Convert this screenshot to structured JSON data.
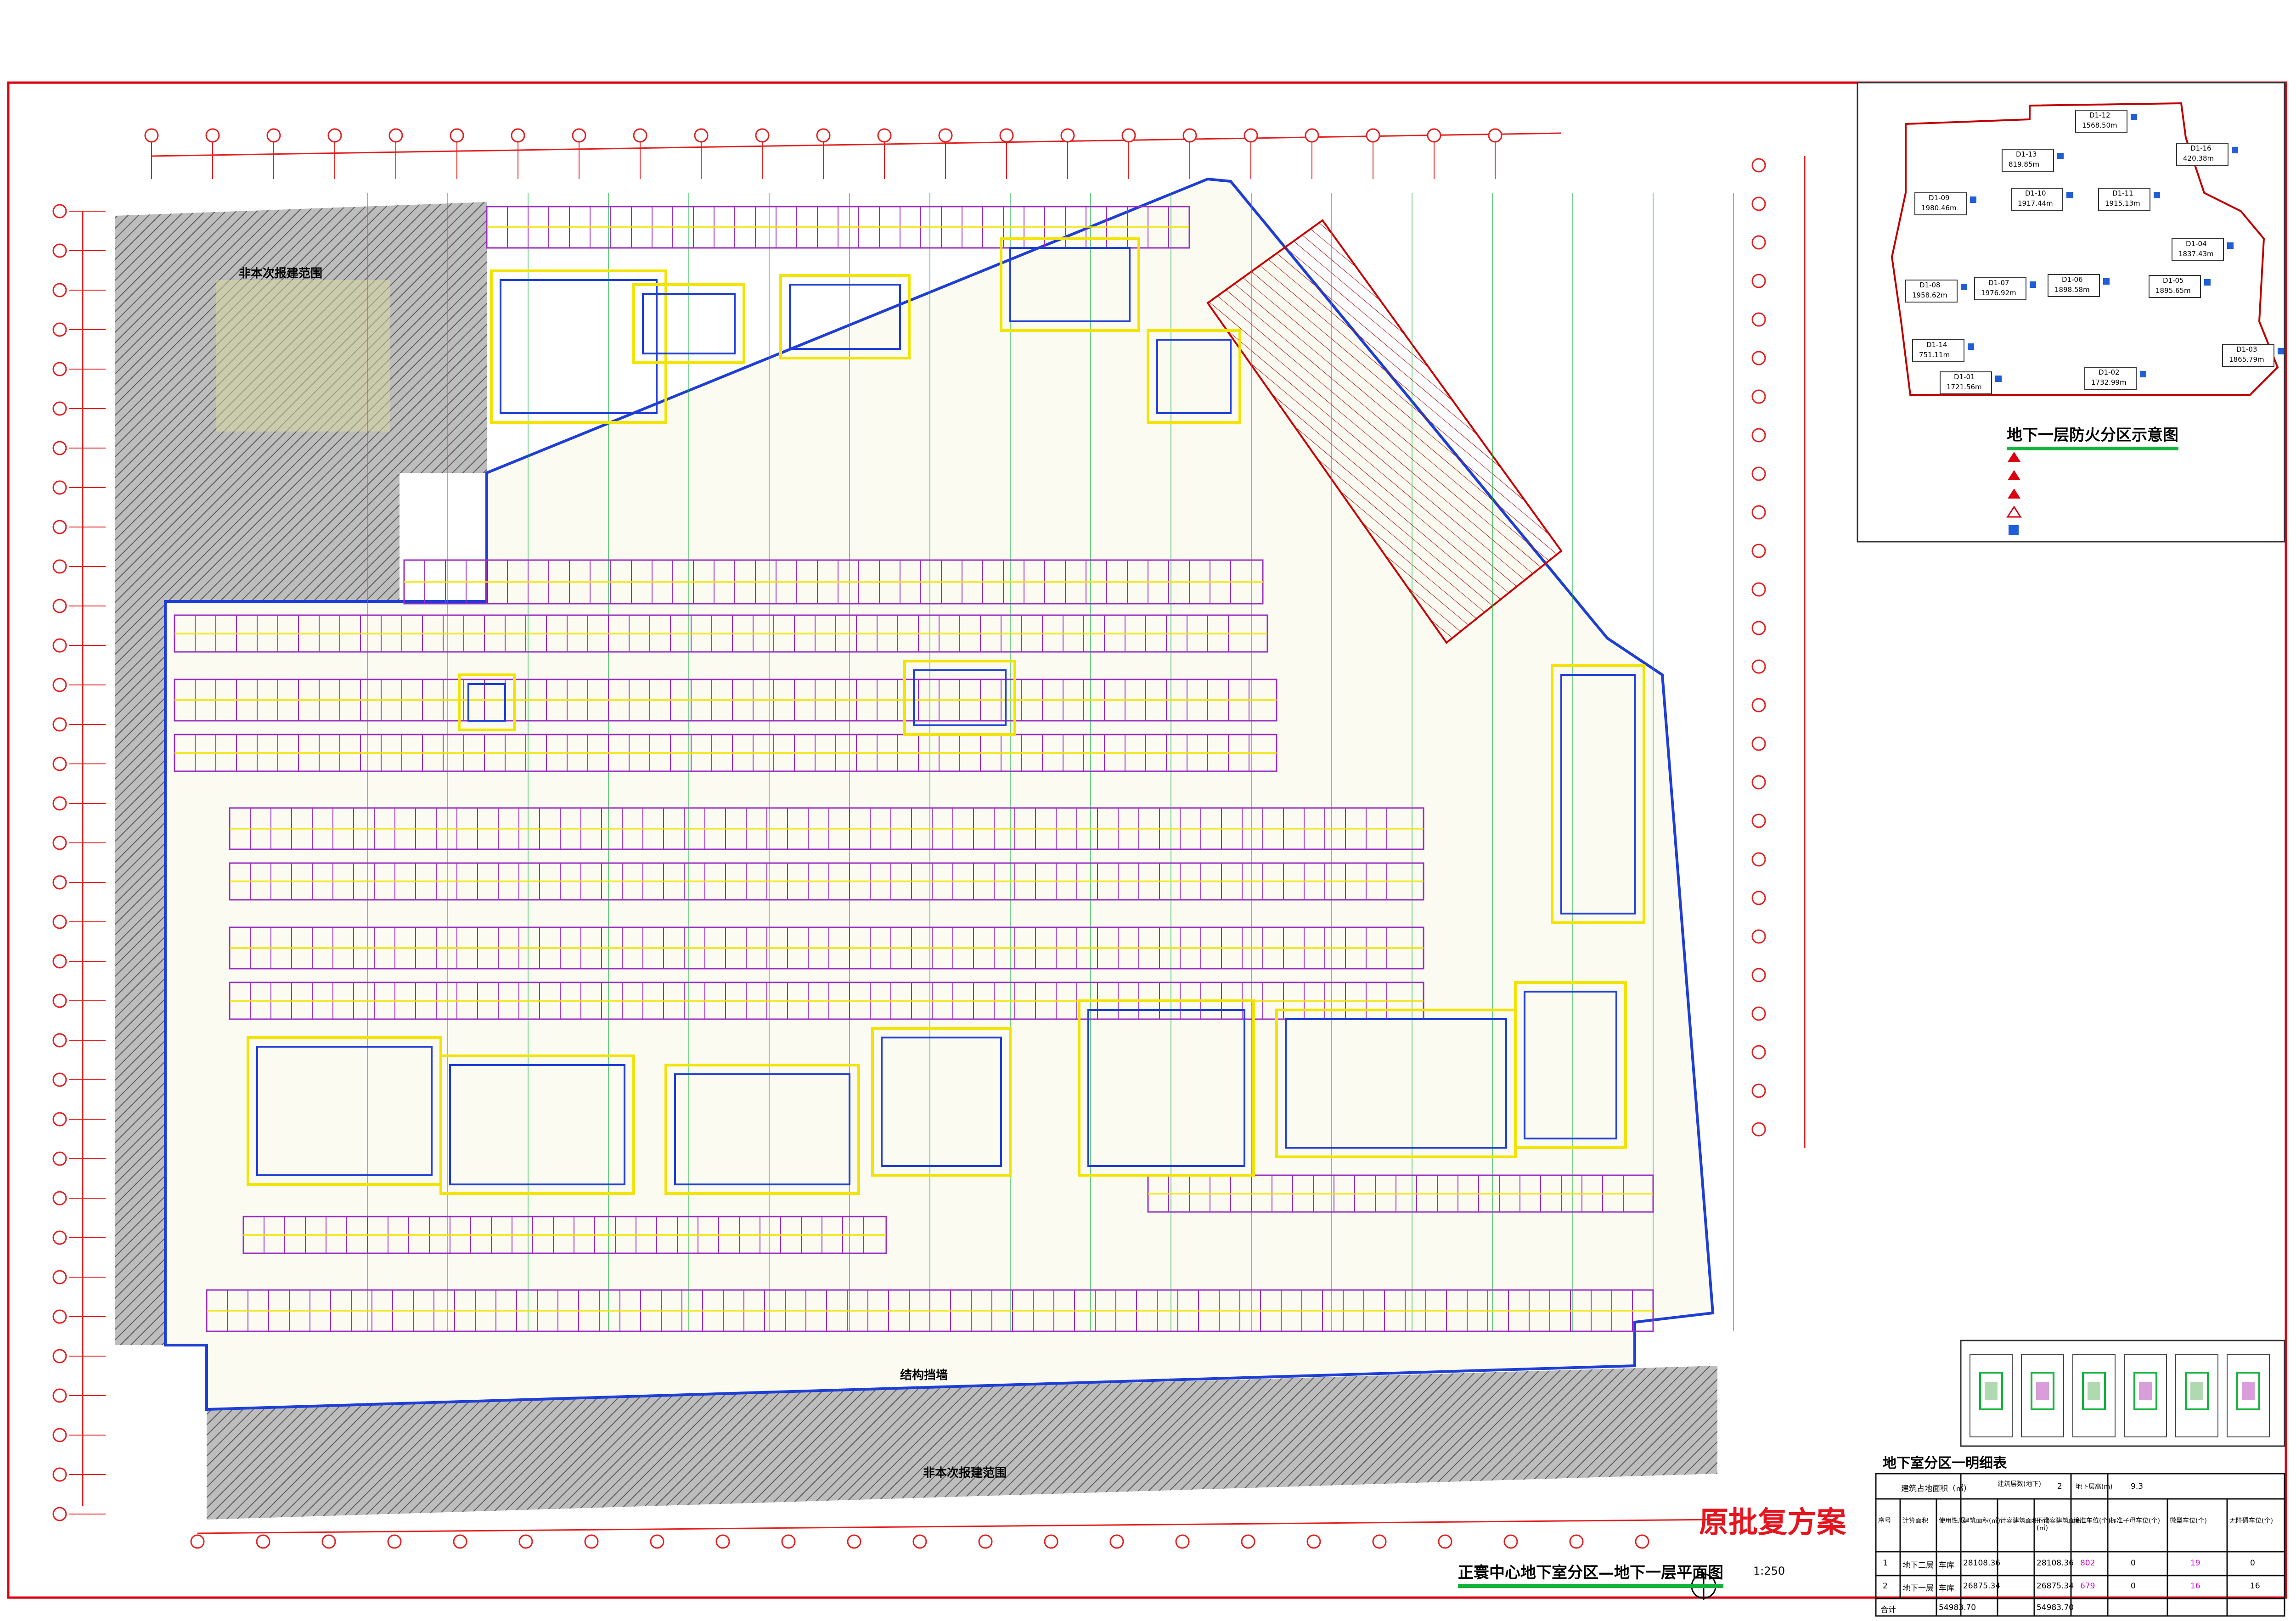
{
  "drawing": {
    "main_title": "正寰中心地下室分区—地下一层平面图",
    "scale": "1:250",
    "stamp": "原批复方案",
    "non_excavation_label": "非本次报建范围",
    "structure_label": "结构挡墙"
  },
  "inset": {
    "title": "地下一层防火分区示意图",
    "zones": [
      {
        "id": "D1-12",
        "area": "1568.50m"
      },
      {
        "id": "D1-13",
        "area": "819.85m"
      },
      {
        "id": "D1-16",
        "area": "420.38m"
      },
      {
        "id": "D1-09",
        "area": "1980.46m"
      },
      {
        "id": "D1-10",
        "area": "1917.44m"
      },
      {
        "id": "D1-11",
        "area": "1915.13m"
      },
      {
        "id": "D1-04",
        "area": "1837.43m"
      },
      {
        "id": "D1-08",
        "area": "1958.62m"
      },
      {
        "id": "D1-07",
        "area": "1976.92m"
      },
      {
        "id": "D1-06",
        "area": "1898.58m"
      },
      {
        "id": "D1-05",
        "area": "1895.65m"
      },
      {
        "id": "D1-14",
        "area": "751.11m"
      },
      {
        "id": "D1-01",
        "area": "1721.56m"
      },
      {
        "id": "D1-02",
        "area": "1732.99m"
      },
      {
        "id": "D1-03",
        "area": "1865.79m"
      }
    ]
  },
  "table": {
    "title": "地下室分区一明细表",
    "row1": {
      "label_a": "建筑占地面积（㎡）",
      "label_b": "建筑层数(地下)",
      "value_b": "2",
      "label_c": "地下层高(m)",
      "value_c": "9.3"
    },
    "headers": [
      "序号",
      "计算面积",
      "使用性质",
      "建筑面积(㎡)",
      "计容建筑面积(㎡)",
      "不计容建筑面积(㎡)",
      "标准车位(个)",
      "标准子母车位(个)",
      "微型车位(个)",
      "无障碍车位(个)"
    ],
    "rows": [
      {
        "no": "1",
        "name": "地下二层",
        "use": "车库",
        "area": "28108.36",
        "area2": "28108.36",
        "std": "802",
        "sub": "0",
        "mini": "19",
        "acc": "0"
      },
      {
        "no": "2",
        "name": "地下一层",
        "use": "车库",
        "area": "26875.34",
        "area2": "26875.34",
        "std": "679",
        "sub": "0",
        "mini": "16",
        "acc": "16"
      }
    ],
    "total": {
      "label": "合计",
      "area": "54983.70",
      "area2": "54983.70"
    }
  },
  "colors": {
    "border": "#d9000f",
    "grid": "#e41e1e",
    "parking": "#9a2ec2",
    "wall": "#1f3ed6",
    "yellow": "#f2e400",
    "green": "#12b33a",
    "hatch": "#555555"
  }
}
